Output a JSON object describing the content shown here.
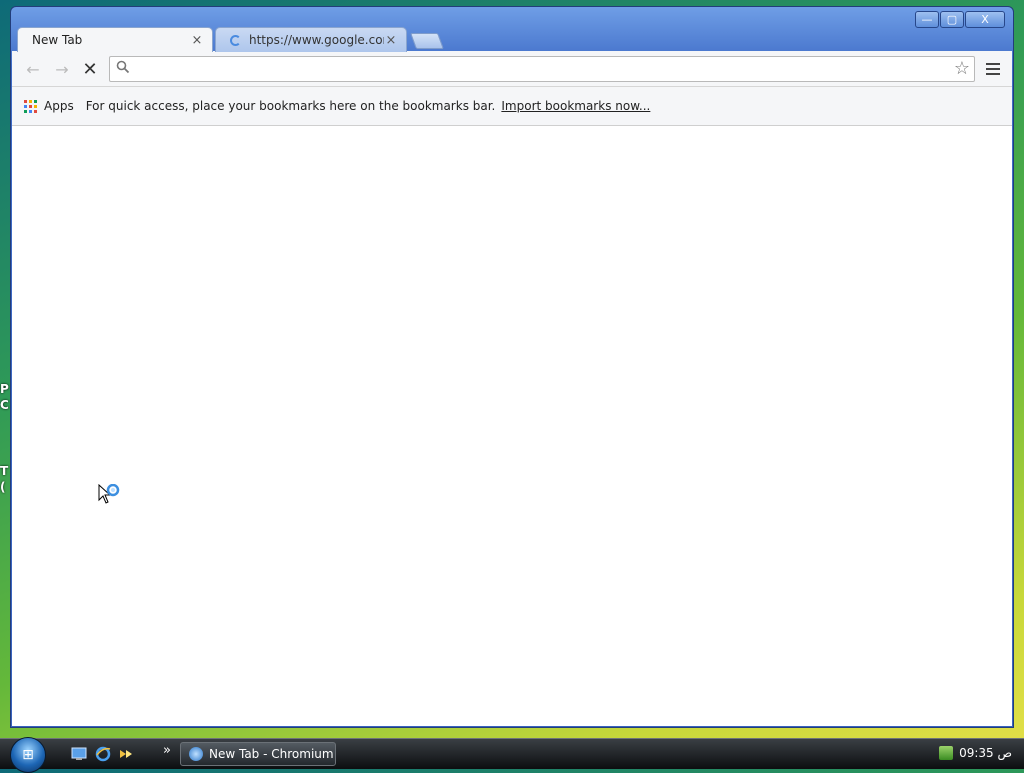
{
  "desktop": {
    "fragments": [
      "P",
      "C",
      "T",
      "("
    ]
  },
  "window": {
    "caption_buttons": {
      "minimize": "—",
      "maximize": "▢",
      "close": "X"
    }
  },
  "tabs": [
    {
      "title": "New Tab",
      "close": "×"
    },
    {
      "title": "https://www.google.com",
      "close": "×"
    }
  ],
  "toolbar": {
    "back": "←",
    "forward": "→",
    "stop": "✕",
    "omnibox_value": "",
    "search_icon": "🔍",
    "star_icon": "☆"
  },
  "bookmarks_bar": {
    "apps_label": "Apps",
    "message": "For quick access, place your bookmarks here on the bookmarks bar.",
    "import_link": "Import bookmarks now..."
  },
  "taskbar": {
    "start_label": "⊞",
    "quick_launch": [
      "show-desktop-icon",
      "ie-icon",
      "media-icon"
    ],
    "more": "»",
    "task_button": "New Tab - Chromium",
    "clock": "09:35 ص"
  },
  "colors": {
    "apps_grid": [
      "#e04a3f",
      "#f4b400",
      "#0f9d58",
      "#4285f4",
      "#e04a3f",
      "#f4b400",
      "#0f9d58",
      "#4285f4",
      "#e04a3f"
    ]
  }
}
